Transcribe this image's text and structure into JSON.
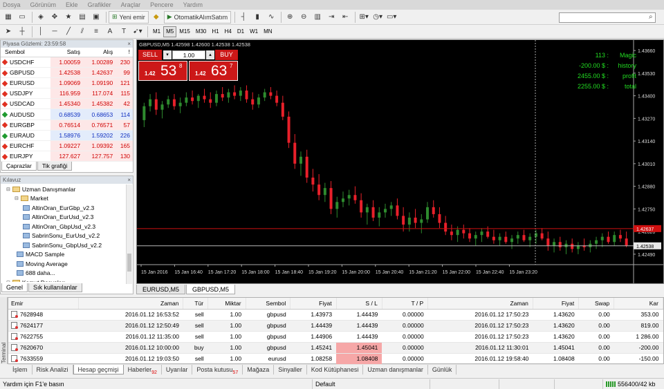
{
  "menu": [
    "Dosya",
    "Görünüm",
    "Ekle",
    "Grafikler",
    "Araçlar",
    "Pencere",
    "Yardım"
  ],
  "toolbar": {
    "new_order": "Yeni emir",
    "auto_trade": "OtomatikAlımSatım"
  },
  "timeframes": [
    "M1",
    "M5",
    "M15",
    "M30",
    "H1",
    "H4",
    "D1",
    "W1",
    "MN"
  ],
  "active_timeframe": "M5",
  "market_watch": {
    "title": "Piyasa Gözlemi: 23:59:58",
    "col_symbol": "Sembol",
    "col_bid": "Satış",
    "col_ask": "Alış",
    "col_flag": "!",
    "rows": [
      {
        "symbol": "USDCHF",
        "bid": "1.00059",
        "ask": "1.00289",
        "spread": "230",
        "up": false
      },
      {
        "symbol": "GBPUSD",
        "bid": "1.42538",
        "ask": "1.42637",
        "spread": "99",
        "up": false
      },
      {
        "symbol": "EURUSD",
        "bid": "1.09069",
        "ask": "1.09190",
        "spread": "121",
        "up": false
      },
      {
        "symbol": "USDJPY",
        "bid": "116.959",
        "ask": "117.074",
        "spread": "115",
        "up": false
      },
      {
        "symbol": "USDCAD",
        "bid": "1.45340",
        "ask": "1.45382",
        "spread": "42",
        "up": false
      },
      {
        "symbol": "AUDUSD",
        "bid": "0.68539",
        "ask": "0.68653",
        "spread": "114",
        "up": true
      },
      {
        "symbol": "EURGBP",
        "bid": "0.76514",
        "ask": "0.76571",
        "spread": "57",
        "up": false
      },
      {
        "symbol": "EURAUD",
        "bid": "1.58976",
        "ask": "1.59202",
        "spread": "226",
        "up": true
      },
      {
        "symbol": "EURCHF",
        "bid": "1.09227",
        "ask": "1.09392",
        "spread": "165",
        "up": false
      },
      {
        "symbol": "EURJPY",
        "bid": "127.627",
        "ask": "127.757",
        "spread": "130",
        "up": false
      }
    ],
    "tabs": [
      "Çaprazlar",
      "Tik grafiği"
    ]
  },
  "navigator": {
    "title": "Kılavuz",
    "items": [
      {
        "label": "Uzman Danışmanlar",
        "indent": 1,
        "icon": "folder"
      },
      {
        "label": "Market",
        "indent": 2,
        "icon": "folder"
      },
      {
        "label": "AltinOran_EurGbp_v2.3",
        "indent": 3,
        "icon": "ea"
      },
      {
        "label": "AltinOran_EurUsd_v2.3",
        "indent": 3,
        "icon": "ea"
      },
      {
        "label": "AltinOran_GbpUsd_v2.3",
        "indent": 3,
        "icon": "ea"
      },
      {
        "label": "SabrinSonu_EurUsd_v2.2",
        "indent": 3,
        "icon": "ea"
      },
      {
        "label": "SabrinSonu_GbpUsd_v2.2",
        "indent": 3,
        "icon": "ea"
      },
      {
        "label": "MACD Sample",
        "indent": 2,
        "icon": "ea"
      },
      {
        "label": "Moving Average",
        "indent": 2,
        "icon": "ea"
      },
      {
        "label": "688 daha...",
        "indent": 2,
        "icon": "ea"
      },
      {
        "label": "Komut Dosyaları",
        "indent": 1,
        "icon": "folder"
      }
    ],
    "tabs": [
      "Genel",
      "Sık kullanılanlar"
    ]
  },
  "chart": {
    "header": "GBPUSD,M5  1.42598 1.42600 1.42538 1.42538",
    "sell_label": "SELL",
    "buy_label": "BUY",
    "lot": "1.00",
    "sell_price_small": "1.42",
    "sell_price_big": "53",
    "sell_price_sup": "8",
    "buy_price_small": "1.42",
    "buy_price_big": "63",
    "buy_price_sup": "7",
    "info": [
      {
        "value": "113 :",
        "label": "Magic"
      },
      {
        "value": "-200.00 $ :",
        "label": "history"
      },
      {
        "value": "2455.00 $ :",
        "label": "profit"
      },
      {
        "value": "2255.00 $ :",
        "label": "total"
      }
    ],
    "price_ticks": [
      "1.43660",
      "1.43530",
      "1.43400",
      "1.43270",
      "1.43140",
      "1.43010",
      "1.42880",
      "1.42750",
      "1.42620",
      "1.42490"
    ],
    "time_ticks": [
      "15 Jan 2016",
      "15 Jan 16:40",
      "15 Jan 17:20",
      "15 Jan 18:00",
      "15 Jan 18:40",
      "15 Jan 19:20",
      "15 Jan 20:00",
      "15 Jan 20:40",
      "15 Jan 21:20",
      "15 Jan 22:00",
      "15 Jan 22:40",
      "15 Jan 23:20"
    ],
    "ask_label": "1.42637",
    "bid_label": "1.42538",
    "tabs": [
      "EURUSD,M5",
      "GBPUSD,M5"
    ],
    "active_tab": 1
  },
  "chart_data": {
    "type": "candlestick",
    "symbol": "GBPUSD",
    "timeframe": "M5",
    "ylim": [
      1.4243,
      1.4372
    ],
    "ask_line": 1.42637,
    "bid_line": 1.42538,
    "candles": [
      [
        1.4326,
        1.4336,
        1.4322,
        1.4334
      ],
      [
        1.4334,
        1.4341,
        1.4331,
        1.4338
      ],
      [
        1.4338,
        1.4342,
        1.4329,
        1.4332
      ],
      [
        1.4332,
        1.4337,
        1.4327,
        1.4335
      ],
      [
        1.4335,
        1.434,
        1.4333,
        1.4338
      ],
      [
        1.4338,
        1.4341,
        1.4332,
        1.4334
      ],
      [
        1.4334,
        1.4339,
        1.433,
        1.4336
      ],
      [
        1.4336,
        1.4342,
        1.4334,
        1.4339
      ],
      [
        1.4339,
        1.4343,
        1.4335,
        1.4337
      ],
      [
        1.4337,
        1.4341,
        1.4333,
        1.434
      ],
      [
        1.434,
        1.4344,
        1.4336,
        1.4338
      ],
      [
        1.4338,
        1.4342,
        1.4333,
        1.4336
      ],
      [
        1.4336,
        1.4343,
        1.4334,
        1.4341
      ],
      [
        1.4341,
        1.4345,
        1.4337,
        1.4339
      ],
      [
        1.4339,
        1.4344,
        1.4336,
        1.4342
      ],
      [
        1.4342,
        1.4346,
        1.4338,
        1.434
      ],
      [
        1.434,
        1.4345,
        1.4337,
        1.4343
      ],
      [
        1.4343,
        1.4346,
        1.4336,
        1.4338
      ],
      [
        1.4338,
        1.4342,
        1.4332,
        1.4335
      ],
      [
        1.4335,
        1.4341,
        1.4333,
        1.4339
      ],
      [
        1.4339,
        1.4344,
        1.4337,
        1.4342
      ],
      [
        1.4342,
        1.4345,
        1.4338,
        1.434
      ],
      [
        1.434,
        1.4343,
        1.4334,
        1.4336
      ],
      [
        1.4336,
        1.434,
        1.4326,
        1.4328
      ],
      [
        1.4328,
        1.4331,
        1.431,
        1.4313
      ],
      [
        1.4313,
        1.4318,
        1.4298,
        1.4301
      ],
      [
        1.4301,
        1.4308,
        1.4294,
        1.4305
      ],
      [
        1.4305,
        1.4309,
        1.429,
        1.4293
      ],
      [
        1.4293,
        1.4298,
        1.4285,
        1.4289
      ],
      [
        1.4289,
        1.4295,
        1.428,
        1.4283
      ],
      [
        1.4283,
        1.429,
        1.4279,
        1.4287
      ],
      [
        1.4287,
        1.4291,
        1.4272,
        1.4275
      ],
      [
        1.4275,
        1.4282,
        1.427,
        1.4279
      ],
      [
        1.4279,
        1.4285,
        1.4276,
        1.4281
      ],
      [
        1.4281,
        1.4286,
        1.4277,
        1.4283
      ],
      [
        1.4283,
        1.4288,
        1.4278,
        1.428
      ],
      [
        1.428,
        1.4284,
        1.427,
        1.4273
      ],
      [
        1.4273,
        1.4278,
        1.4266,
        1.4276
      ],
      [
        1.4276,
        1.428,
        1.4268,
        1.427
      ],
      [
        1.427,
        1.4276,
        1.4265,
        1.4273
      ],
      [
        1.4273,
        1.4278,
        1.427,
        1.4275
      ],
      [
        1.4275,
        1.4279,
        1.4271,
        1.4277
      ],
      [
        1.4277,
        1.4281,
        1.4269,
        1.4271
      ],
      [
        1.4271,
        1.4276,
        1.4262,
        1.4266
      ],
      [
        1.4266,
        1.4273,
        1.4262,
        1.427
      ],
      [
        1.427,
        1.4275,
        1.4264,
        1.4267
      ],
      [
        1.4267,
        1.4272,
        1.4261,
        1.4269
      ],
      [
        1.4269,
        1.4279,
        1.4267,
        1.4276
      ],
      [
        1.4276,
        1.428,
        1.427,
        1.4272
      ],
      [
        1.4272,
        1.4276,
        1.4264,
        1.4267
      ],
      [
        1.4267,
        1.4271,
        1.426,
        1.4262
      ],
      [
        1.4262,
        1.4266,
        1.4257,
        1.426
      ],
      [
        1.426,
        1.4265,
        1.4256,
        1.4263
      ],
      [
        1.4263,
        1.4266,
        1.4258,
        1.4261
      ],
      [
        1.4261,
        1.4264,
        1.4256,
        1.4258
      ],
      [
        1.4258,
        1.4262,
        1.4254,
        1.426
      ],
      [
        1.426,
        1.4264,
        1.4256,
        1.4262
      ],
      [
        1.4262,
        1.4265,
        1.4258,
        1.4259
      ],
      [
        1.4259,
        1.4263,
        1.4255,
        1.4257
      ],
      [
        1.4257,
        1.4261,
        1.4254,
        1.4259
      ],
      [
        1.4259,
        1.4262,
        1.4255,
        1.4256
      ],
      [
        1.4256,
        1.426,
        1.4252,
        1.4258
      ],
      [
        1.4258,
        1.4262,
        1.4255,
        1.426
      ],
      [
        1.426,
        1.4263,
        1.4256,
        1.4257
      ],
      [
        1.4257,
        1.4261,
        1.4253,
        1.4259
      ],
      [
        1.4259,
        1.4263,
        1.4255,
        1.4261
      ],
      [
        1.4261,
        1.4264,
        1.4257,
        1.4258
      ],
      [
        1.4258,
        1.4262,
        1.4251,
        1.4254
      ],
      [
        1.4254,
        1.4258,
        1.425,
        1.4256
      ],
      [
        1.4256,
        1.4259,
        1.4251,
        1.4253
      ],
      [
        1.4253,
        1.4257,
        1.4249,
        1.4255
      ],
      [
        1.4255,
        1.4258,
        1.425,
        1.4252
      ],
      [
        1.4252,
        1.4256,
        1.4249,
        1.4254
      ],
      [
        1.4254,
        1.4258,
        1.4251,
        1.4253
      ],
      [
        1.4253,
        1.4257,
        1.425,
        1.4255
      ],
      [
        1.4255,
        1.4259,
        1.4252,
        1.4257
      ],
      [
        1.4257,
        1.4261,
        1.4253,
        1.4259
      ],
      [
        1.4259,
        1.4262,
        1.4255,
        1.4256
      ],
      [
        1.4256,
        1.4262,
        1.4254,
        1.426
      ],
      [
        1.426,
        1.4263,
        1.4256,
        1.4258
      ],
      [
        1.4258,
        1.4262,
        1.4253,
        1.4254
      ]
    ]
  },
  "terminal": {
    "side_label": "Terminal",
    "columns": [
      "Emir",
      "Zaman",
      "Tür",
      "Miktar",
      "Sembol",
      "Fiyat",
      "S / L",
      "T / P",
      "Zaman",
      "Fiyat",
      "Swap",
      "Kar"
    ],
    "rows": [
      {
        "order": "7628948",
        "time": "2016.01.12 16:53:52",
        "type": "sell",
        "size": "1.00",
        "symbol": "gbpusd",
        "price": "1.43973",
        "sl": "1.44439",
        "tp": "0.00000",
        "ctime": "2016.01.12 17:50:23",
        "cprice": "1.43620",
        "swap": "0.00",
        "profit": "353.00",
        "sl_hit": false
      },
      {
        "order": "7624177",
        "time": "2016.01.12 12:50:49",
        "type": "sell",
        "size": "1.00",
        "symbol": "gbpusd",
        "price": "1.44439",
        "sl": "1.44439",
        "tp": "0.00000",
        "ctime": "2016.01.12 17:50:23",
        "cprice": "1.43620",
        "swap": "0.00",
        "profit": "819.00",
        "sl_hit": false
      },
      {
        "order": "7622755",
        "time": "2016.01.12 11:35:00",
        "type": "sell",
        "size": "1.00",
        "symbol": "gbpusd",
        "price": "1.44906",
        "sl": "1.44439",
        "tp": "0.00000",
        "ctime": "2016.01.12 17:50:23",
        "cprice": "1.43620",
        "swap": "0.00",
        "profit": "1 286.00",
        "sl_hit": false
      },
      {
        "order": "7620670",
        "time": "2016.01.12 10:00:00",
        "type": "buy",
        "size": "1.00",
        "symbol": "gbpusd",
        "price": "1.45241",
        "sl": "1.45041",
        "tp": "0.00000",
        "ctime": "2016.01.12 11:30:01",
        "cprice": "1.45041",
        "swap": "0.00",
        "profit": "-200.00",
        "sl_hit": true
      },
      {
        "order": "7633559",
        "time": "2016.01.12 19:03:50",
        "type": "sell",
        "size": "1.00",
        "symbol": "eurusd",
        "price": "1.08258",
        "sl": "1.08408",
        "tp": "0.00000",
        "ctime": "2016.01.12 19:58:40",
        "cprice": "1.08408",
        "swap": "0.00",
        "profit": "-150.00",
        "sl_hit": true
      }
    ],
    "tabs": [
      {
        "label": "İşlem",
        "badge": ""
      },
      {
        "label": "Risk Analizi",
        "badge": ""
      },
      {
        "label": "Hesap geçmişi",
        "badge": "",
        "active": true
      },
      {
        "label": "Haberler",
        "badge": "92"
      },
      {
        "label": "Uyarılar",
        "badge": ""
      },
      {
        "label": "Posta kutusu",
        "badge": "57"
      },
      {
        "label": "Mağaza",
        "badge": ""
      },
      {
        "label": "Sinyaller",
        "badge": ""
      },
      {
        "label": "Kod Kütüphanesi",
        "badge": ""
      },
      {
        "label": "Uzman danışmanlar",
        "badge": ""
      },
      {
        "label": "Günlük",
        "badge": ""
      }
    ]
  },
  "status": {
    "help": "Yardım için F1'e basın",
    "profile": "Default",
    "traffic": "556400/42 kb"
  },
  "colors": {
    "bull": "#2e8b2e",
    "bear": "#e8202a",
    "chart_bg": "#000000",
    "info_text": "#22dd22",
    "sell_btn": "#cc1818"
  }
}
